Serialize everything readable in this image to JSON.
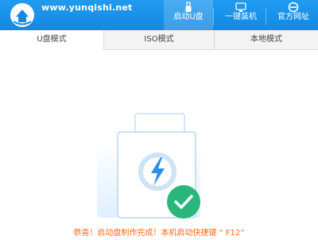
{
  "header": {
    "site_url": "www.yunqishi.net",
    "nav": [
      {
        "label": "启动U盘",
        "icon": "usb-icon",
        "active": true
      },
      {
        "label": "一键装机",
        "icon": "monitor-icon",
        "active": false
      },
      {
        "label": "官方网址",
        "icon": "browser-icon",
        "active": false
      }
    ]
  },
  "tabs": [
    {
      "label": "U盘模式",
      "active": true
    },
    {
      "label": "ISO模式",
      "active": false
    },
    {
      "label": "本地模式",
      "active": false
    }
  ],
  "message": "恭喜！启动盘制作完成！本机启动快捷键 “ F12”",
  "colors": {
    "header_blue": "#1588e3",
    "success_green": "#2ab57a",
    "message_orange": "#ff6a1a"
  }
}
